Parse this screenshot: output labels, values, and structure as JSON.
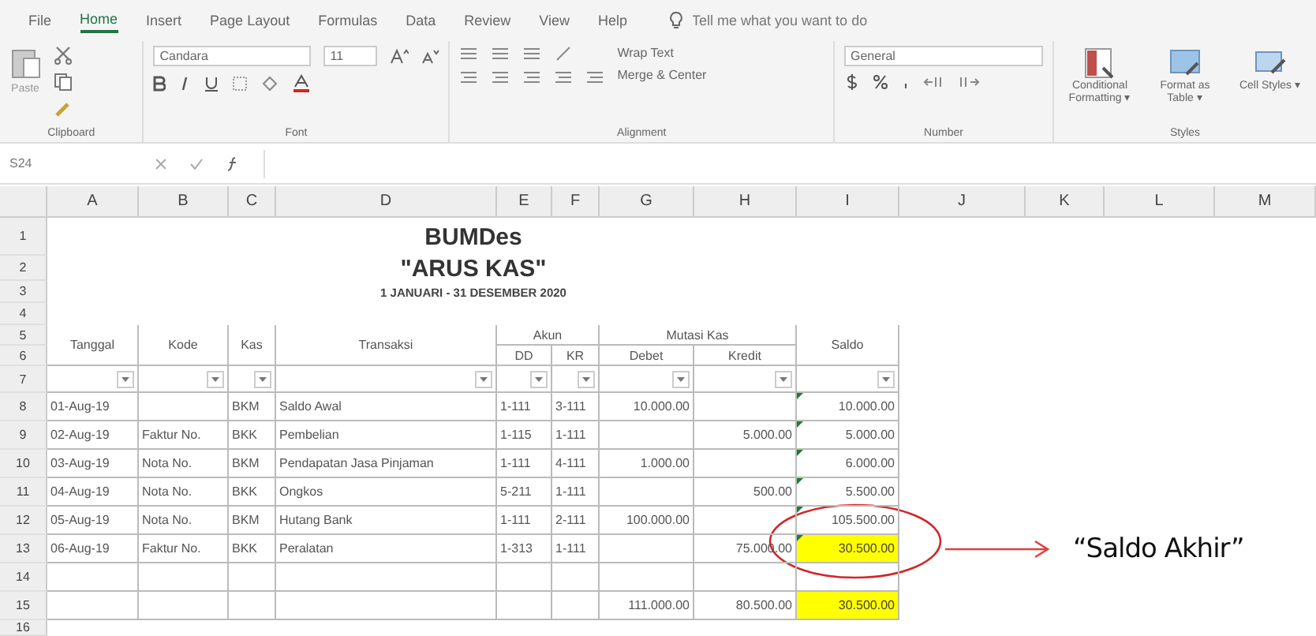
{
  "menu_tabs": [
    {
      "label": "File",
      "selected": false
    },
    {
      "label": "Home",
      "selected": true
    },
    {
      "label": "Insert",
      "selected": false
    },
    {
      "label": "Page Layout",
      "selected": false
    },
    {
      "label": "Formulas",
      "selected": false
    },
    {
      "label": "Data",
      "selected": false
    },
    {
      "label": "Review",
      "selected": false
    },
    {
      "label": "View",
      "selected": false
    },
    {
      "label": "Help",
      "selected": false
    }
  ],
  "tell_me": {
    "placeholder": "Tell me what you want to do"
  },
  "ribbon": {
    "clipboard": {
      "paste": "Paste",
      "group": "Clipboard"
    },
    "font": {
      "name": "Candara",
      "size": "11",
      "group": "Font"
    },
    "alignment": {
      "wrap": "Wrap Text",
      "merge": "Merge & Center",
      "group": "Alignment"
    },
    "number": {
      "format": "General",
      "group": "Number"
    },
    "styles": {
      "conditional": "Conditional Formatting ▾",
      "format_table": "Format as Table ▾",
      "cell_styles": "Cell Styles ▾",
      "group": "Styles"
    }
  },
  "formula_bar": {
    "name_box": "S24"
  },
  "column_headers": [
    "A",
    "B",
    "C",
    "D",
    "E",
    "F",
    "G",
    "H",
    "I",
    "J",
    "K",
    "L",
    "M"
  ],
  "row_headers": [
    "1",
    "2",
    "3",
    "4",
    "5",
    "6",
    "7",
    "8",
    "9",
    "10",
    "11",
    "12",
    "13",
    "14",
    "15",
    "16"
  ],
  "sheet": {
    "title": "BUMDes",
    "title2": "\"ARUS KAS\"",
    "period": "1 JANUARI - 31 DESEMBER 2020",
    "headers": {
      "tanggal": "Tanggal",
      "kode": "Kode",
      "kas": "Kas",
      "transaksi": "Transaksi",
      "akun": "Akun",
      "dd": "DD",
      "kr": "KR",
      "mutasi": "Mutasi Kas",
      "debet": "Debet",
      "kredit": "Kredit",
      "saldo": "Saldo"
    },
    "rows": [
      {
        "tanggal": "01-Aug-19",
        "kode": "",
        "kas": "BKM",
        "transaksi": "Saldo Awal",
        "dd": "1-111",
        "kr": "3-111",
        "debet": "10.000.00",
        "kredit": "",
        "saldo": "10.000.00",
        "highlight": false
      },
      {
        "tanggal": "02-Aug-19",
        "kode": "Faktur No.",
        "kas": "BKK",
        "transaksi": "Pembelian",
        "dd": "1-115",
        "kr": "1-111",
        "debet": "",
        "kredit": "5.000.00",
        "saldo": "5.000.00",
        "highlight": false
      },
      {
        "tanggal": "03-Aug-19",
        "kode": "Nota No.",
        "kas": "BKM",
        "transaksi": "Pendapatan Jasa Pinjaman",
        "dd": "1-111",
        "kr": "4-111",
        "debet": "1.000.00",
        "kredit": "",
        "saldo": "6.000.00",
        "highlight": false
      },
      {
        "tanggal": "04-Aug-19",
        "kode": "Nota No.",
        "kas": "BKK",
        "transaksi": "Ongkos",
        "dd": "5-211",
        "kr": "1-111",
        "debet": "",
        "kredit": "500.00",
        "saldo": "5.500.00",
        "highlight": false
      },
      {
        "tanggal": "05-Aug-19",
        "kode": "Nota No.",
        "kas": "BKM",
        "transaksi": "Hutang Bank",
        "dd": "1-111",
        "kr": "2-111",
        "debet": "100.000.00",
        "kredit": "",
        "saldo": "105.500.00",
        "highlight": false
      },
      {
        "tanggal": "06-Aug-19",
        "kode": "Faktur No.",
        "kas": "BKK",
        "transaksi": "Peralatan",
        "dd": "1-313",
        "kr": "1-111",
        "debet": "",
        "kredit": "75.000.00",
        "saldo": "30.500.00",
        "highlight": true
      }
    ],
    "total": {
      "debet": "111.000.00",
      "kredit": "80.500.00",
      "saldo": "30.500.00",
      "highlight": true
    },
    "annotation": {
      "label": "“Saldo Akhir”"
    }
  }
}
